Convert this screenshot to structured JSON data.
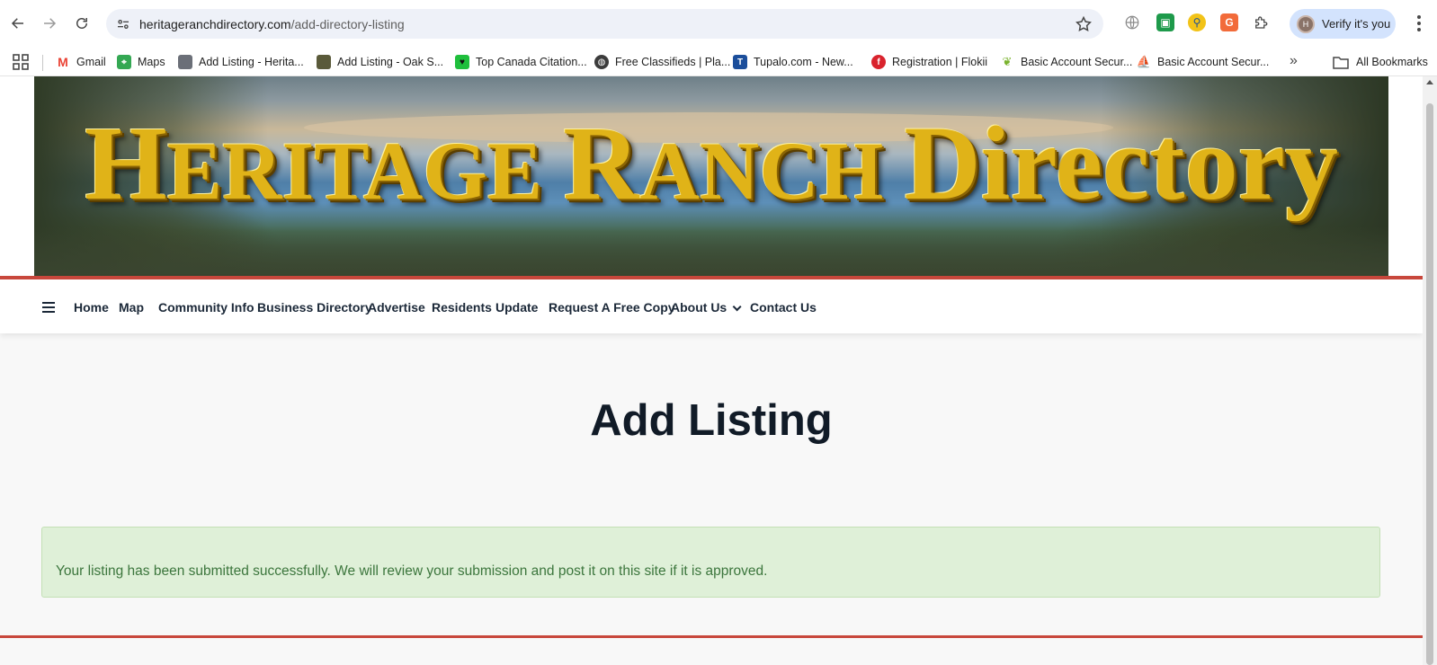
{
  "browser": {
    "url_domain": "heritageranchdirectory.com",
    "url_path": "/add-directory-listing",
    "profile_label": "Verify it's you",
    "profile_initial": "H"
  },
  "bookmarks": {
    "items": [
      {
        "label": "Gmail",
        "icon": "gmail-icon",
        "color": "#ea4335"
      },
      {
        "label": "Maps",
        "icon": "maps-icon",
        "color": "#34a853"
      },
      {
        "label": "Add Listing - Herita...",
        "icon": "heritage-favicon",
        "color": "#6b6f78"
      },
      {
        "label": "Add Listing - Oak S...",
        "icon": "oak-favicon",
        "color": "#5a5a3a"
      },
      {
        "label": "Top Canada Citation...",
        "icon": "citation-favicon",
        "color": "#1fbf3c"
      },
      {
        "label": "Free Classifieds | Pla...",
        "icon": "globe-icon",
        "color": "#3c3c3c"
      },
      {
        "label": "Tupalo.com - New...",
        "icon": "tupalo-favicon",
        "color": "#1b4e9b"
      },
      {
        "label": "Registration | Flokii",
        "icon": "flokii-favicon",
        "color": "#d9232d"
      },
      {
        "label": "Basic Account Secur...",
        "icon": "leaf-favicon",
        "color": "#7ab32e"
      },
      {
        "label": "Basic Account Secur...",
        "icon": "ship-favicon",
        "color": "#2b3b6e"
      }
    ],
    "more_label": "»",
    "all_bookmarks_label": "All Bookmarks"
  },
  "site": {
    "banner_title_parts": [
      "H",
      "ERITAGE ",
      "R",
      "ANCH ",
      "Directory"
    ],
    "nav": [
      {
        "label": "Home"
      },
      {
        "label": "Map"
      },
      {
        "label": "Community Info"
      },
      {
        "label": "Business Directory"
      },
      {
        "label": "Advertise"
      },
      {
        "label": "Residents"
      },
      {
        "label": "Update"
      },
      {
        "label": "Request A Free Copy"
      },
      {
        "label": "About Us"
      },
      {
        "label": "Contact Us"
      }
    ],
    "page_title": "Add Listing",
    "alert_message": "Your listing has been submitted successfully. We will review your submission and post it on this site if it is approved."
  },
  "colors": {
    "accent_red": "#c8473c",
    "nav_text": "#1b2838",
    "alert_bg": "#dff0d8",
    "alert_text": "#3c763d",
    "banner_gold": "#e0b318"
  }
}
